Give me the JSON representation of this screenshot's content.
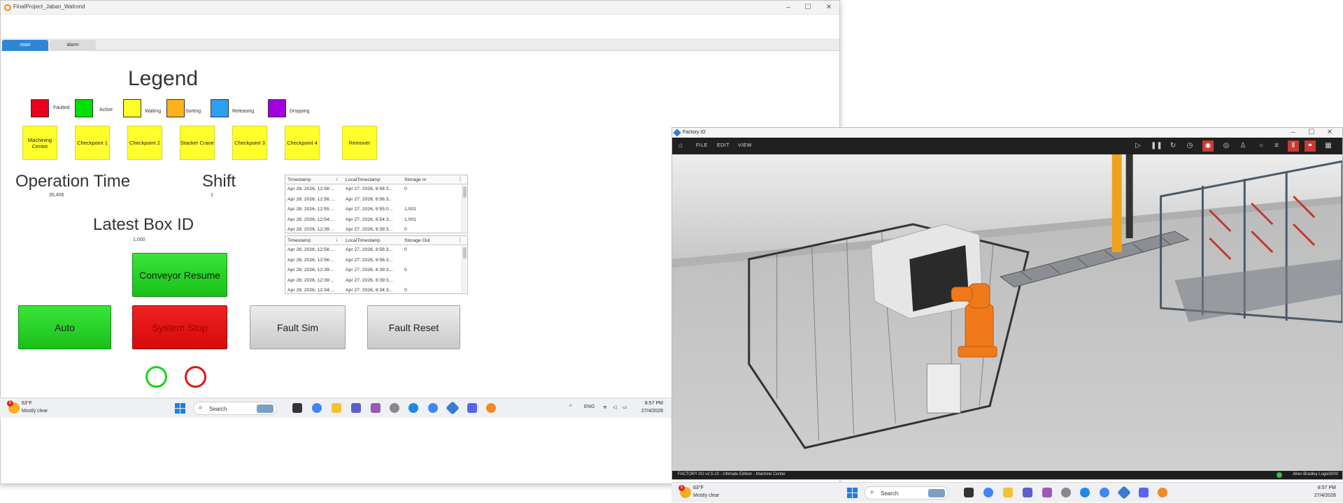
{
  "hmi": {
    "title": "FinalProject_Jabari_Walrond",
    "tabs": [
      {
        "label": "main"
      },
      {
        "label": "alarm"
      }
    ],
    "legend": {
      "title": "Legend",
      "items": [
        {
          "label": "Faulted",
          "color": "#e8001c"
        },
        {
          "label": "Active",
          "color": "#00e000"
        },
        {
          "label": "Waiting",
          "color": "#ffff2b"
        },
        {
          "label": "Sorting",
          "color": "#ffb31a"
        },
        {
          "label": "Releasing",
          "color": "#2f9ff0"
        },
        {
          "label": "Dropping",
          "color": "#a000e0"
        }
      ]
    },
    "stations": [
      {
        "label": "Machining Centre"
      },
      {
        "label": "Checkpoint 1"
      },
      {
        "label": "Checkpoint 2"
      },
      {
        "label": "Stacker Crane"
      },
      {
        "label": "Checkpoint 3"
      },
      {
        "label": "Checkpoint 4"
      },
      {
        "label": "Remover"
      }
    ],
    "operation_time": {
      "label": "Operation Time",
      "value": "35,406"
    },
    "shift": {
      "label": "Shift",
      "value": "1"
    },
    "latest_box": {
      "label": "Latest Box ID",
      "value": "1,000"
    },
    "buttons": {
      "conveyor_resume": "Conveyor Resume",
      "auto": "Auto",
      "system_stop": "System Stop",
      "fault_sim": "Fault Sim",
      "fault_reset": "Fault Reset"
    },
    "indicators": {
      "green": "#18d418",
      "red": "#e01414"
    },
    "storage_in_table": {
      "headers": [
        "Timestamp",
        "LocalTimestamp",
        "Storage In"
      ],
      "rows": [
        [
          "Apr 28, 2026, 12:56:...",
          "Apr 27, 2026, 8:56:3...",
          "0"
        ],
        [
          "Apr 28, 2026, 12:56:...",
          "Apr 27, 2026, 8:56:3...",
          ""
        ],
        [
          "Apr 28, 2026, 12:55:...",
          "Apr 27, 2026, 8:55:0...",
          "1,002"
        ],
        [
          "Apr 28, 2026, 12:54:...",
          "Apr 27, 2026, 8:54:3...",
          "1,001"
        ],
        [
          "Apr 28, 2026, 12:39:...",
          "Apr 27, 2026, 8:39:3...",
          "0"
        ]
      ]
    },
    "storage_out_table": {
      "headers": [
        "Timestamp",
        "LocalTimestamp",
        "Storage Out"
      ],
      "rows": [
        [
          "Apr 28, 2026, 12:56:...",
          "Apr 27, 2026, 8:56:3...",
          "0"
        ],
        [
          "Apr 28, 2026, 12:56:...",
          "Apr 27, 2026, 8:56:3...",
          ""
        ],
        [
          "Apr 28, 2026, 12:39:...",
          "Apr 27, 2026, 8:39:3...",
          "0"
        ],
        [
          "Apr 28, 2026, 12:39:...",
          "Apr 27, 2026, 8:39:3...",
          ""
        ],
        [
          "Apr 28, 2026, 12:34:...",
          "Apr 27, 2026, 8:34:3...",
          "0"
        ]
      ]
    }
  },
  "factoryio": {
    "title": "Factory IO",
    "menu": [
      "FILE",
      "EDIT",
      "VIEW"
    ],
    "status_left": "FACTORY I/O v2.5.10 - Ultimate Edition - Machine Center",
    "status_right": "Allen-Bradley Logix5000"
  },
  "taskbar": {
    "weather_temp": "63°F",
    "weather_cond": "Mostly clear",
    "weather_badge": "5",
    "search": "Search",
    "lang": "ENG",
    "time": "8:57 PM",
    "date": "27/4/2026",
    "app_colors": [
      "#333333",
      "#e8b32a",
      "#f1c232",
      "#5b5fc7",
      "#9b59b6",
      "#888888",
      "#1e88e5",
      "#4285f4",
      "#5b6bcf",
      "#5865f2",
      "#f08a24"
    ]
  }
}
